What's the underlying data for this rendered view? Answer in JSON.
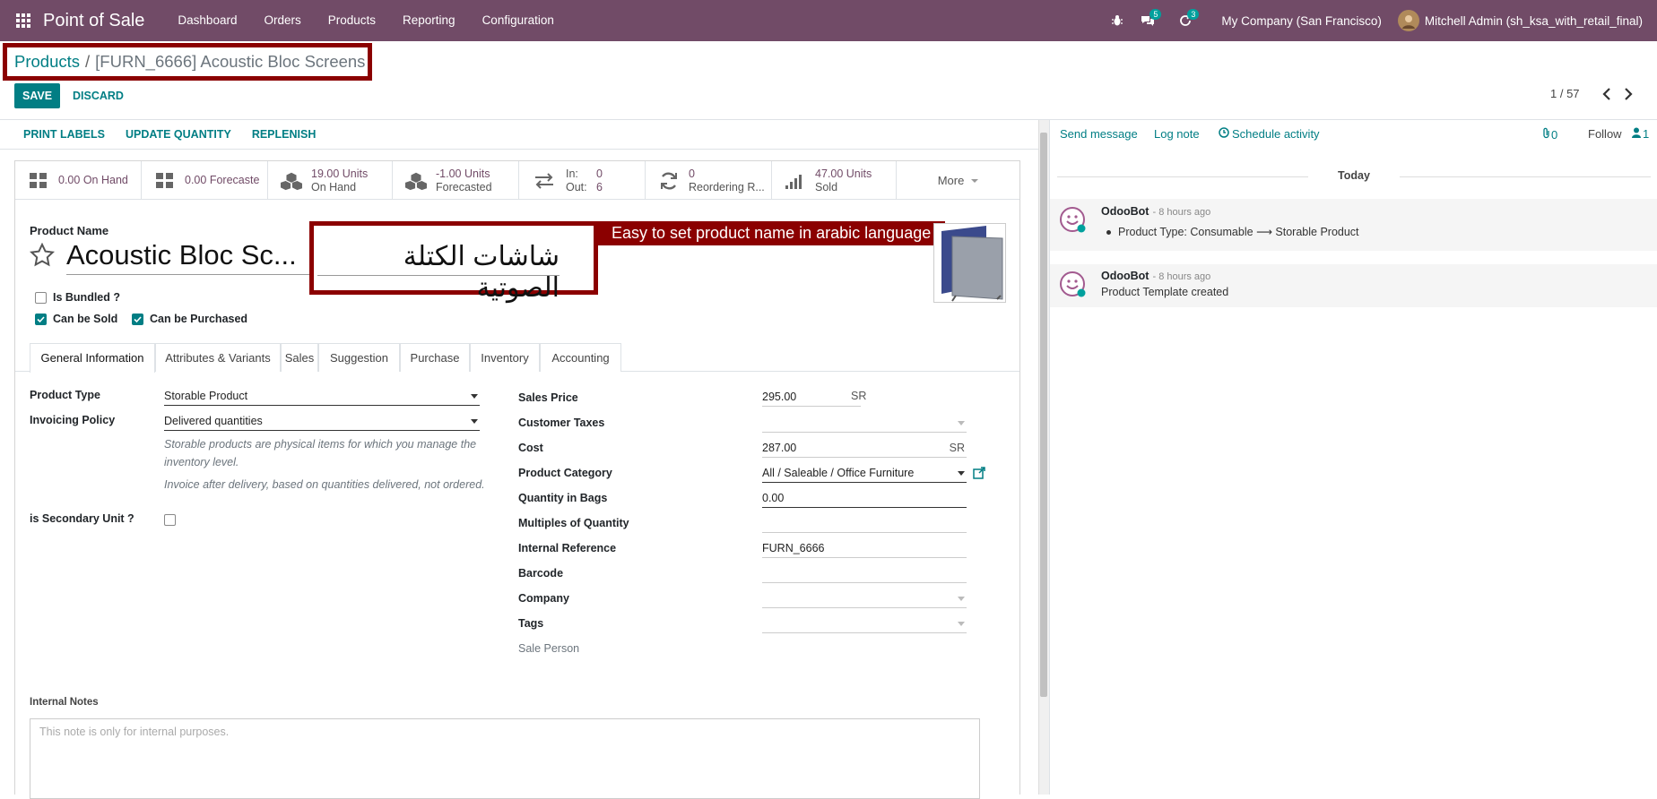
{
  "navbar": {
    "app_name": "Point of Sale",
    "menu": [
      "Dashboard",
      "Orders",
      "Products",
      "Reporting",
      "Configuration"
    ],
    "messages_count": "5",
    "activities_count": "3",
    "company": "My Company (San Francisco)",
    "user": "Mitchell Admin (sh_ksa_with_retail_final)"
  },
  "breadcrumb": {
    "parent": "Products",
    "separator": "/",
    "current": "[FURN_6666] Acoustic Bloc Screens"
  },
  "form_buttons": {
    "save": "SAVE",
    "discard": "DISCARD"
  },
  "pager": {
    "value": "1 / 57"
  },
  "actions": [
    "PRINT LABELS",
    "UPDATE QUANTITY",
    "REPLENISH"
  ],
  "smart_buttons": [
    {
      "value": "0.00",
      "label": "On Hand",
      "inline": true,
      "icon": "grid-icon"
    },
    {
      "value": "0.00",
      "label": "Forecaste",
      "inline": true,
      "icon": "grid-icon"
    },
    {
      "value": "19.00 Units",
      "label": "On Hand",
      "inline": false,
      "icon": "cubes-icon"
    },
    {
      "value": "-1.00 Units",
      "label": "Forecasted",
      "inline": false,
      "icon": "cubes-icon"
    },
    {
      "value_in_label": "In:",
      "value_in": "0",
      "value_out_label": "Out:",
      "value_out": "6",
      "icon": "exchange-icon"
    },
    {
      "value": "0",
      "label": "Reordering R...",
      "inline": false,
      "icon": "refresh-icon"
    },
    {
      "value": "47.00 Units",
      "label": "Sold",
      "inline": false,
      "icon": "signal-icon"
    }
  ],
  "more_label": "More",
  "product": {
    "name_label": "Product Name",
    "name": "Acoustic Bloc Sc...",
    "name_arabic": "شاشات الكتلة الصوتية",
    "callout": "Easy to set product name in arabic language",
    "is_bundled_label": "Is Bundled ?",
    "is_bundled": false,
    "can_be_sold_label": "Can be Sold",
    "can_be_sold": true,
    "can_be_purchased_label": "Can be Purchased",
    "can_be_purchased": true
  },
  "tabs": [
    "General Information",
    "Attributes & Variants",
    "Sales",
    "Suggestion",
    "Purchase",
    "Inventory",
    "Accounting"
  ],
  "general": {
    "product_type_label": "Product Type",
    "product_type": "Storable Product",
    "invoicing_policy_label": "Invoicing Policy",
    "invoicing_policy": "Delivered quantities",
    "help_storable": "Storable products are physical items for which you manage the inventory level.",
    "help_invoice": "Invoice after delivery, based on quantities delivered, not ordered.",
    "secondary_unit_label": "is Secondary Unit ?",
    "sales_price_label": "Sales Price",
    "sales_price": "295.00",
    "currency": "SR",
    "customer_taxes_label": "Customer Taxes",
    "customer_taxes": "",
    "cost_label": "Cost",
    "cost": "287.00",
    "product_category_label": "Product Category",
    "product_category": "All / Saleable / Office Furniture",
    "qty_bags_label": "Quantity in Bags",
    "qty_bags": "0.00",
    "multiples_label": "Multiples of Quantity",
    "multiples": "",
    "internal_ref_label": "Internal Reference",
    "internal_ref": "FURN_6666",
    "barcode_label": "Barcode",
    "barcode": "",
    "company_label": "Company",
    "company": "",
    "tags_label": "Tags",
    "tags": "",
    "sale_person_label": "Sale Person"
  },
  "notes": {
    "label": "Internal Notes",
    "placeholder": "This note is only for internal purposes."
  },
  "chatter": {
    "send_message": "Send message",
    "log_note": "Log note",
    "schedule_activity": "Schedule activity",
    "attachments": "0",
    "follow": "Follow",
    "followers": "1",
    "today": "Today",
    "messages": [
      {
        "author": "OdooBot",
        "date": "- 8 hours ago",
        "body": "Product Type: Consumable ⟶ Storable Product",
        "bullet": true
      },
      {
        "author": "OdooBot",
        "date": "- 8 hours ago",
        "body": "Product Template created",
        "bullet": false
      }
    ]
  },
  "colors": {
    "brand": "#714b67",
    "accent": "#017e84",
    "highlight": "#8b0000"
  }
}
